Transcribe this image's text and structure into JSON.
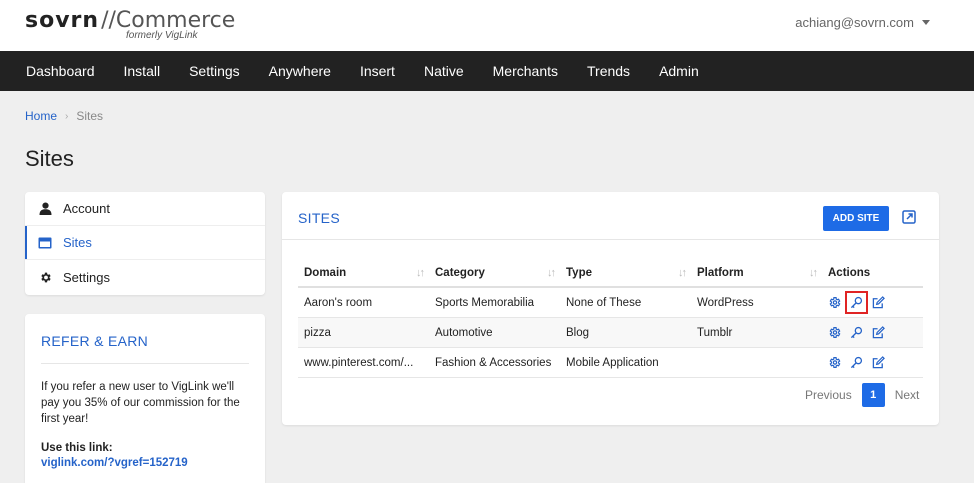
{
  "header": {
    "logo_main": "sovrn",
    "logo_commerce": "//Commerce",
    "logo_sub": "formerly VigLink",
    "user_email": "achiang@sovrn.com"
  },
  "nav": {
    "items": [
      "Dashboard",
      "Install",
      "Settings",
      "Anywhere",
      "Insert",
      "Native",
      "Merchants",
      "Trends",
      "Admin"
    ]
  },
  "breadcrumb": {
    "home": "Home",
    "separator": "›",
    "current": "Sites"
  },
  "page_title": "Sites",
  "sidebar": {
    "items": [
      {
        "label": "Account",
        "icon": "user-icon"
      },
      {
        "label": "Sites",
        "icon": "window-icon",
        "active": true
      },
      {
        "label": "Settings",
        "icon": "gear-icon"
      }
    ]
  },
  "refer": {
    "title": "REFER & EARN",
    "text": "If you refer a new user to VigLink we'll pay you 35% of our commission for the first year!",
    "use_label": "Use this link:",
    "link": "viglink.com/?vgref=152719"
  },
  "sites": {
    "title": "SITES",
    "add_label": "ADD SITE",
    "columns": [
      "Domain",
      "Category",
      "Type",
      "Platform",
      "Actions"
    ],
    "sort_glyph": "↓↑",
    "rows": [
      {
        "domain": "Aaron's room",
        "category": "Sports Memorabilia",
        "type": "None of These",
        "platform": "WordPress"
      },
      {
        "domain": "pizza",
        "category": "Automotive",
        "type": "Blog",
        "platform": "Tumblr"
      },
      {
        "domain": "www.pinterest.com/...",
        "category": "Fashion & Accessories",
        "type": "Mobile Application",
        "platform": ""
      }
    ],
    "pager": {
      "previous": "Previous",
      "current": "1",
      "next": "Next"
    }
  },
  "colors": {
    "accent": "#1e6be6",
    "link": "#2563c9",
    "nav_bg": "#222222",
    "highlight": "#e02424"
  }
}
